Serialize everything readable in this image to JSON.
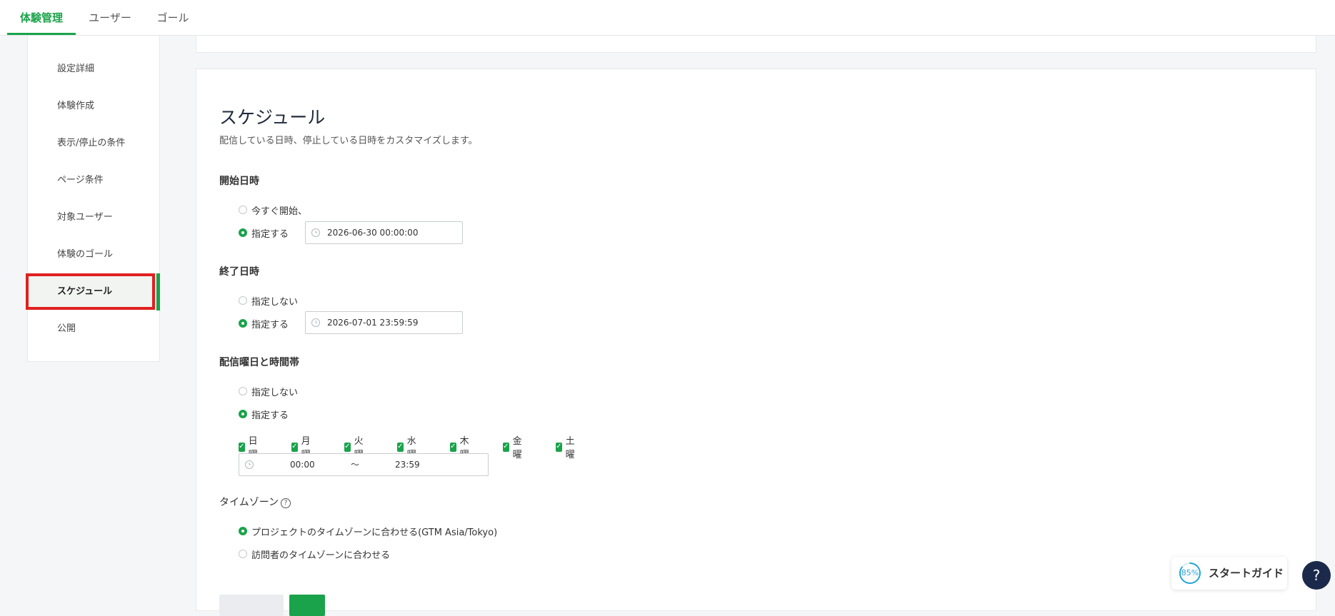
{
  "topnav": {
    "tabs": [
      {
        "label": "体験管理",
        "active": true
      },
      {
        "label": "ユーザー",
        "active": false
      },
      {
        "label": "ゴール",
        "active": false
      }
    ]
  },
  "sidebar": {
    "items": [
      {
        "label": "設定詳細"
      },
      {
        "label": "体験作成"
      },
      {
        "label": "表示/停止の条件"
      },
      {
        "label": "ページ条件"
      },
      {
        "label": "対象ユーザー"
      },
      {
        "label": "体験のゴール"
      },
      {
        "label": "スケジュール",
        "active": true
      },
      {
        "label": "公開"
      }
    ]
  },
  "schedule": {
    "title": "スケジュール",
    "description": "配信している日時、停止している日時をカスタマイズします。",
    "start": {
      "label": "開始日時",
      "options": [
        "今すぐ開始、",
        "指定する"
      ],
      "selected": "指定する",
      "datetime": "2026-06-30 00:00:00"
    },
    "end": {
      "label": "終了日時",
      "options": [
        "指定しない",
        "指定する"
      ],
      "selected": "指定する",
      "datetime": "2026-07-01 23:59:59"
    },
    "weekday": {
      "label": "配信曜日と時間帯",
      "options": [
        "指定しない",
        "指定する"
      ],
      "selected": "指定する",
      "days": [
        "日曜",
        "月曜",
        "火曜",
        "水曜",
        "木曜",
        "金曜",
        "土曜"
      ],
      "all_checked": true,
      "time_from": "00:00",
      "time_separator": "〜",
      "time_to": "23:59"
    },
    "timezone": {
      "label": "タイムゾーン",
      "options": [
        "プロジェクトのタイムゾーンに合わせる(GTM Asia/Tokyo)",
        "訪問者のタイムゾーンに合わせる"
      ],
      "selected": "プロジェクトのタイムゾーンに合わせる(GTM Asia/Tokyo)"
    }
  },
  "guide": {
    "progress_percent": 85,
    "progress_label": "85%",
    "label": "スタートガイド"
  },
  "help_button": {
    "label": "?"
  },
  "colors": {
    "accent": "#1aa34a",
    "highlight": "#e12020",
    "help_bg": "#1b2a4a",
    "guide_ring": "#2aa3d8"
  }
}
